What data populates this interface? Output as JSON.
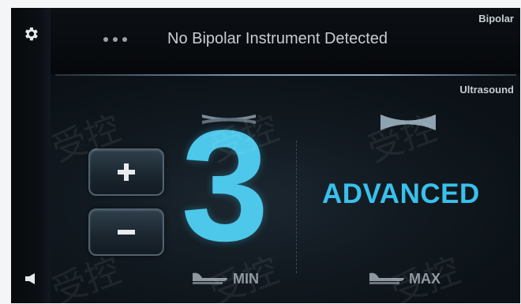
{
  "bipolar": {
    "section_label": "Bipolar",
    "status_text": "No Bipolar Instrument Detected"
  },
  "ultrasound": {
    "section_label": "Ultrasound",
    "level": "3",
    "mode": "ADVANCED",
    "min_label": "MIN",
    "max_label": "MAX",
    "increase_label": "+",
    "decrease_label": "−"
  },
  "sidebar": {
    "icons": [
      "gear-icon",
      "speaker-icon"
    ]
  },
  "watermark": {
    "text": "受控"
  },
  "colors": {
    "accent": "#3fc3ee",
    "text_light": "#c8ced3",
    "background": "#090d11"
  }
}
